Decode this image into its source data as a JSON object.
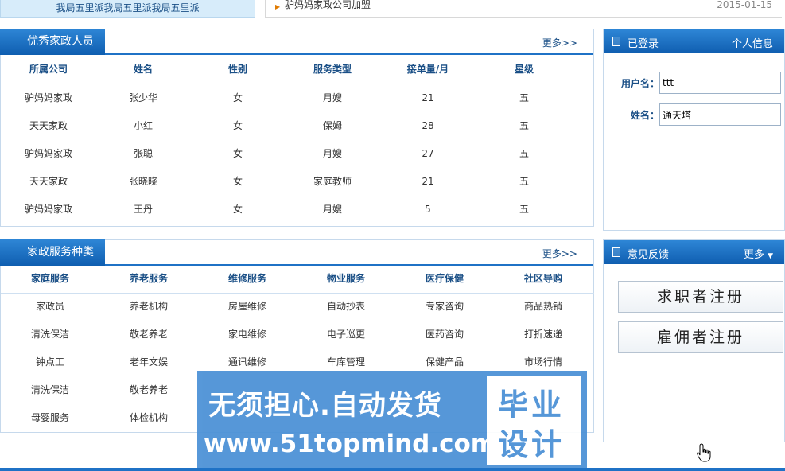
{
  "top": {
    "left_text": "我局五里派我局五里派我局五里派",
    "news_title": "驴妈妈家政公司加盟",
    "news_date": "2015-01-15"
  },
  "staff": {
    "title": "优秀家政人员",
    "more": "更多>>",
    "columns": [
      "所属公司",
      "姓名",
      "性别",
      "服务类型",
      "接单量/月",
      "星级"
    ],
    "rows": [
      [
        "驴妈妈家政",
        "张少华",
        "女",
        "月嫂",
        "21",
        "五"
      ],
      [
        "天天家政",
        "小红",
        "女",
        "保姆",
        "28",
        "五"
      ],
      [
        "驴妈妈家政",
        "张聪",
        "女",
        "月嫂",
        "27",
        "五"
      ],
      [
        "天天家政",
        "张晓晓",
        "女",
        "家庭教师",
        "21",
        "五"
      ],
      [
        "驴妈妈家政",
        "王丹",
        "女",
        "月嫂",
        "5",
        "五"
      ]
    ]
  },
  "services": {
    "title": "家政服务种类",
    "more": "更多>>",
    "columns": [
      "家庭服务",
      "养老服务",
      "维修服务",
      "物业服务",
      "医疗保健",
      "社区导购"
    ],
    "rows": [
      [
        "家政员",
        "养老机构",
        "房屋维修",
        "自动抄表",
        "专家咨询",
        "商品热销"
      ],
      [
        "清洗保洁",
        "敬老养老",
        "家电维修",
        "电子巡更",
        "医药咨询",
        "打折速递"
      ],
      [
        "钟点工",
        "老年文娱",
        "通讯维修",
        "车库管理",
        "保健产品",
        "市场行情"
      ],
      [
        "清洗保洁",
        "敬老养老",
        "",
        "",
        "",
        ""
      ],
      [
        "母婴服务",
        "体检机构",
        "",
        "",
        "",
        ""
      ]
    ]
  },
  "login": {
    "title": "已登录",
    "link": "个人信息",
    "username_label": "用户名：",
    "username_value": "ttt",
    "name_label": "姓名：",
    "name_value": "通天塔"
  },
  "feedback": {
    "title": "意见反馈",
    "more": "更多",
    "btn_jobseeker": "求职者注册",
    "btn_employer": "雇佣者注册"
  },
  "watermark": {
    "line1": "无须担心.自动发货",
    "line2": "www.51topmind.com",
    "badge1": "毕业",
    "badge2": "设计"
  },
  "colors": {
    "primary": "#1f72c6",
    "header_text": "#1a4f86",
    "watermark": "#4a90d6"
  }
}
